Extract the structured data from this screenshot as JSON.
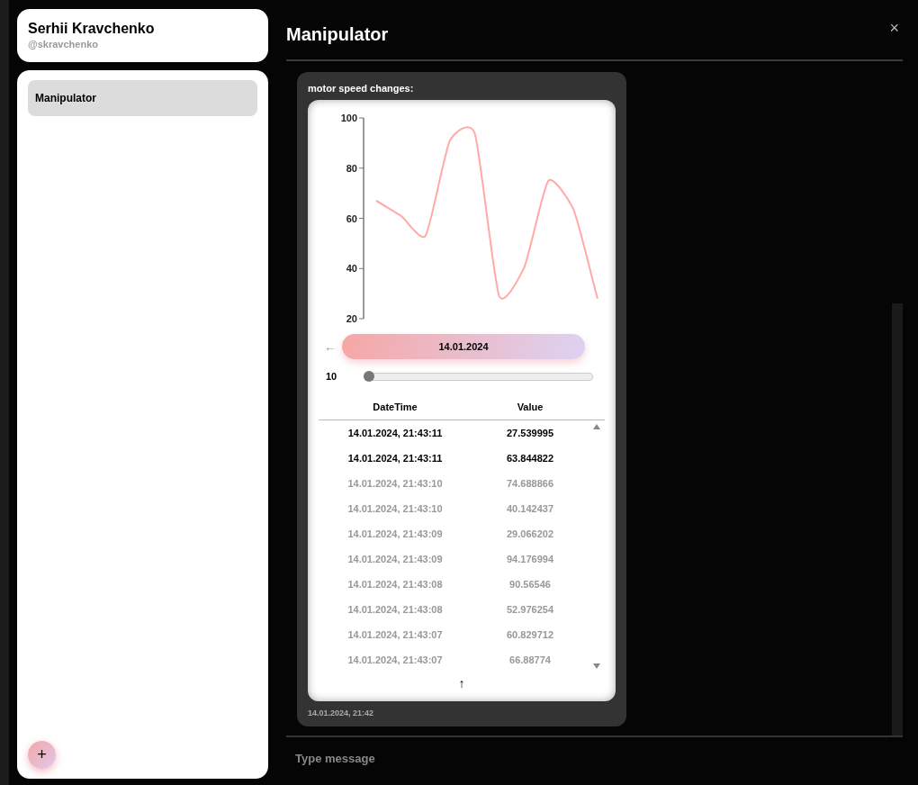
{
  "profile": {
    "name": "Serhii Kravchenko",
    "handle": "@skravchenko"
  },
  "sidebar": {
    "items": [
      {
        "label": "Manipulator",
        "selected": true
      }
    ],
    "add_button": "+"
  },
  "header": {
    "title": "Manipulator",
    "close": "×"
  },
  "message": {
    "title": "motor speed changes:",
    "chart_data": {
      "type": "line",
      "series": [
        {
          "color": "#ffaaa5",
          "values": [
            67,
            61,
            53,
            91,
            94,
            29,
            40,
            75,
            64,
            28
          ]
        }
      ],
      "ylim": [
        20,
        100
      ],
      "yticks": [
        20,
        40,
        60,
        80,
        100
      ]
    },
    "date_nav": {
      "back": "←",
      "date": "14.01.2024"
    },
    "slider": {
      "label": "10",
      "level": 0
    },
    "table": {
      "columns": [
        "DateTime",
        "Value"
      ],
      "rows": [
        {
          "cells": [
            "14.01.2024, 21:43:11",
            "27.539995"
          ],
          "highlighted": true
        },
        {
          "cells": [
            "14.01.2024, 21:43:11",
            "63.844822"
          ],
          "highlighted": true
        },
        {
          "cells": [
            "14.01.2024, 21:43:10",
            "74.688866"
          ],
          "highlighted": false
        },
        {
          "cells": [
            "14.01.2024, 21:43:10",
            "40.142437"
          ],
          "highlighted": false
        },
        {
          "cells": [
            "14.01.2024, 21:43:09",
            "29.066202"
          ],
          "highlighted": false
        },
        {
          "cells": [
            "14.01.2024, 21:43:09",
            "94.176994"
          ],
          "highlighted": false
        },
        {
          "cells": [
            "14.01.2024, 21:43:08",
            "90.56546"
          ],
          "highlighted": false
        },
        {
          "cells": [
            "14.01.2024, 21:43:08",
            "52.976254"
          ],
          "highlighted": false
        },
        {
          "cells": [
            "14.01.2024, 21:43:07",
            "60.829712"
          ],
          "highlighted": false
        },
        {
          "cells": [
            "14.01.2024, 21:43:07",
            "66.88774"
          ],
          "highlighted": false
        }
      ]
    },
    "scroll_top": "↑",
    "timestamp": "14.01.2024, 21:42"
  },
  "composer": {
    "placeholder": "Type message"
  }
}
